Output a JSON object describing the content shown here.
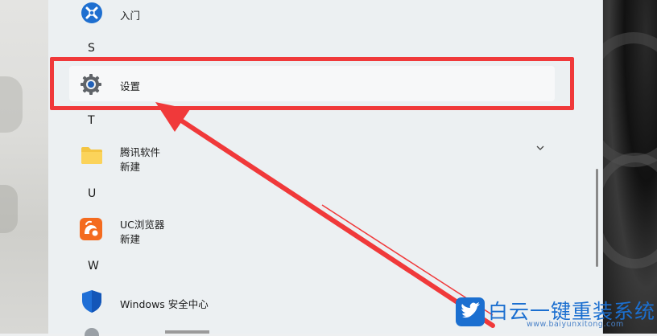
{
  "groups": {
    "r": {
      "letter": "S"
    },
    "t": {
      "letter": "T"
    },
    "u": {
      "letter": "U"
    },
    "w": {
      "letter": "W"
    }
  },
  "apps": {
    "rumen": {
      "name": "入门",
      "icon": "get-started-icon"
    },
    "settings": {
      "name": "设置",
      "icon": "gear-icon"
    },
    "tencent": {
      "name": "腾讯软件",
      "sub": "新建",
      "icon": "folder-icon"
    },
    "uc": {
      "name": "UC浏览器",
      "sub": "新建",
      "icon": "uc-browser-icon"
    },
    "security": {
      "name": "Windows 安全中心",
      "icon": "windows-security-shield-icon"
    }
  },
  "watermark": {
    "title": "白云一键重装系统",
    "url": "www.baiyunxitong.com"
  },
  "colors": {
    "highlight": "#f0393a",
    "watermark_blue": "#1b6fd0"
  }
}
